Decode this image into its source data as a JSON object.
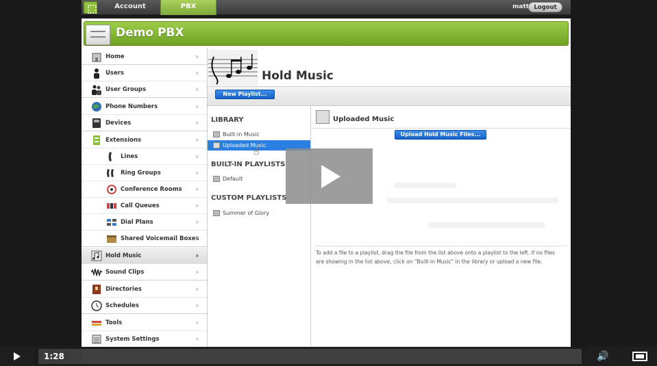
{
  "top_nav": {
    "tabs": [
      {
        "label": "Account"
      },
      {
        "label": "PBX",
        "active": true
      }
    ],
    "username": "matt",
    "logout_label": "Logout"
  },
  "banner": {
    "title": "Demo PBX"
  },
  "sidebar": {
    "items": [
      {
        "label": "Home",
        "icon": "home-icon"
      },
      {
        "label": "Users",
        "icon": "user-icon"
      },
      {
        "label": "User Groups",
        "icon": "users-icon"
      },
      {
        "label": "Phone Numbers",
        "icon": "globe-icon"
      },
      {
        "label": "Devices",
        "icon": "phone-device-icon"
      },
      {
        "label": "Extensions",
        "icon": "extensions-icon"
      },
      {
        "label": "Lines",
        "icon": "handset-icon",
        "sub": true
      },
      {
        "label": "Ring Groups",
        "icon": "ring-group-icon",
        "sub": true
      },
      {
        "label": "Conference Rooms",
        "icon": "conference-icon",
        "sub": true
      },
      {
        "label": "Call Queues",
        "icon": "queue-icon",
        "sub": true
      },
      {
        "label": "Dial Plans",
        "icon": "dial-plan-icon",
        "sub": true
      },
      {
        "label": "Shared Voicemail Boxes",
        "icon": "voicemail-icon",
        "sub": true
      },
      {
        "label": "Hold Music",
        "icon": "music-icon",
        "active": true
      },
      {
        "label": "Sound Clips",
        "icon": "waveform-icon"
      },
      {
        "label": "Directories",
        "icon": "directory-icon"
      },
      {
        "label": "Schedules",
        "icon": "clock-icon"
      },
      {
        "label": "Tools",
        "icon": "tools-icon"
      },
      {
        "label": "System Settings",
        "icon": "settings-icon"
      }
    ]
  },
  "page": {
    "title": "Hold Music",
    "new_playlist_label": "New Playlist..."
  },
  "library": {
    "heading": "LIBRARY",
    "items": [
      {
        "label": "Built-in Music"
      },
      {
        "label": "Uploaded Music",
        "selected": true
      }
    ],
    "builtin_heading": "BUILT-IN PLAYLISTS",
    "builtin_items": [
      {
        "label": "Default"
      }
    ],
    "custom_heading": "CUSTOM PLAYLISTS",
    "custom_items": [
      {
        "label": "Summer of Glory"
      }
    ]
  },
  "files_panel": {
    "title": "Uploaded Music",
    "upload_label": "Upload Hold Music Files...",
    "hint": "To add a file to a playlist, drag the file from the list above onto a playlist to the left. If no files are showing in the list above, click on \"Built-in Music\" in the library or upload a new file."
  },
  "video": {
    "time": "1:28",
    "progress_fraction": 0.08
  },
  "colors": {
    "accent_green": "#8bbf3d",
    "selection_blue": "#2a7fe0",
    "button_blue": "#1f72d8"
  }
}
